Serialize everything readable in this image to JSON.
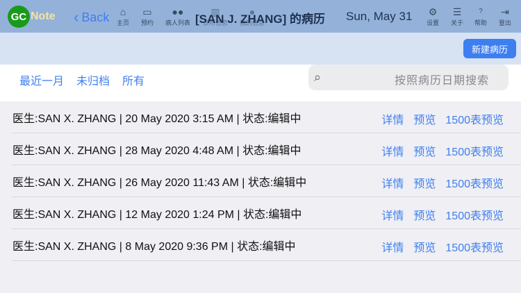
{
  "header": {
    "logo_gc": "GC",
    "logo_note": "Note",
    "back": "Back",
    "nav": [
      {
        "icon": "home-icon",
        "label": "主页"
      },
      {
        "icon": "calendar-icon",
        "label": "预约"
      },
      {
        "icon": "patients-icon",
        "label": "病人列表"
      },
      {
        "icon": "building-icon",
        "label": "诊所信息"
      },
      {
        "icon": "person-icon",
        "label": "我的信息"
      }
    ],
    "title": "[SAN J. ZHANG] 的病历",
    "date": "Sun, May 31",
    "right_nav": [
      {
        "icon": "gear-icon",
        "label": "设置"
      },
      {
        "icon": "list-icon",
        "label": "关于"
      },
      {
        "icon": "help-icon",
        "label": "帮助"
      },
      {
        "icon": "logout-icon",
        "label": "登出"
      }
    ]
  },
  "toolbar": {
    "new_record": "新建病历"
  },
  "filters": {
    "tabs": [
      "最近一月",
      "未归档",
      "所有"
    ],
    "search_placeholder": "按照病历日期搜索"
  },
  "records": [
    {
      "text": "医生:SAN X. ZHANG | 20 May 2020 3:15 AM | 状态:编辑中"
    },
    {
      "text": "医生:SAN X. ZHANG | 28 May 2020 4:48 AM | 状态:编辑中"
    },
    {
      "text": "医生:SAN X. ZHANG | 26 May 2020 11:43 AM | 状态:编辑中"
    },
    {
      "text": "医生:SAN X. ZHANG | 12 May 2020 1:24 PM | 状态:编辑中"
    },
    {
      "text": "医生:SAN X. ZHANG | 8 May 2020 9:36 PM | 状态:编辑中"
    }
  ],
  "actions": {
    "detail": "详情",
    "preview": "预览",
    "form1500": "1500表预览"
  }
}
